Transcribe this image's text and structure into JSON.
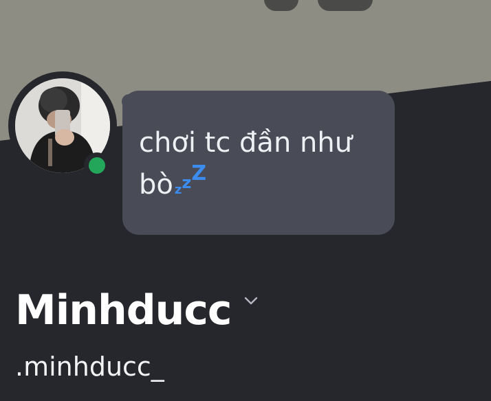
{
  "profile": {
    "display_name": "Minhducc",
    "username": ".minhducc_",
    "custom_status": {
      "line1": "chơi tc đần như",
      "line2": "bò",
      "emoji": "sleeping-zzz-icon",
      "emoji_chars": [
        "z",
        "z",
        "Z"
      ]
    },
    "presence": "online"
  },
  "colors": {
    "banner": "#8d8d83",
    "panel": "#26272d",
    "bubble": "#494b56",
    "online": "#23a55a",
    "zzz": "#3c8cf0"
  },
  "icons": {
    "expand": "chevron-down-icon",
    "avatar": "avatar-photo"
  }
}
